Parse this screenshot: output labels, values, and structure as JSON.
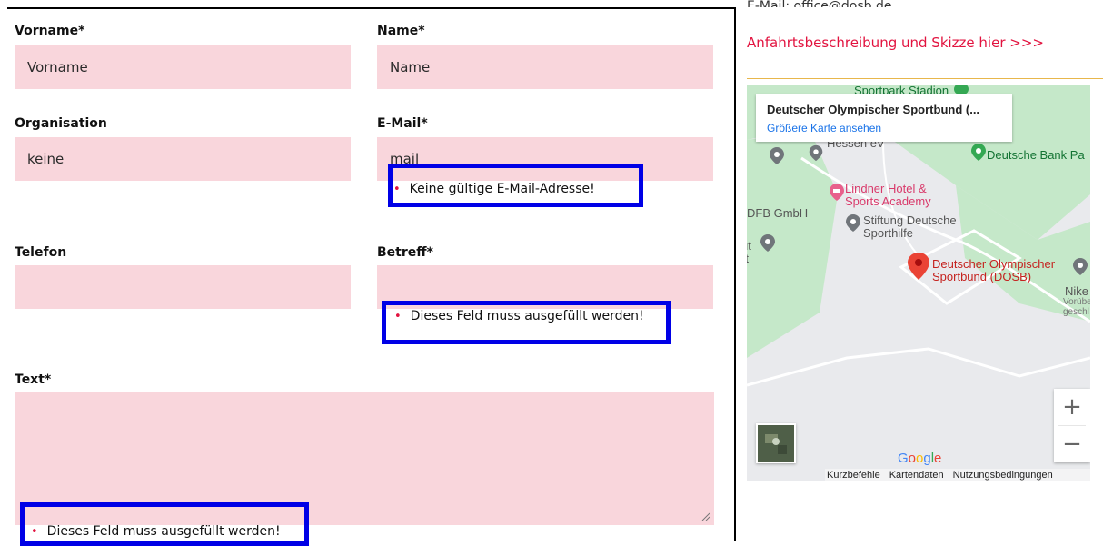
{
  "form": {
    "vorname": {
      "label": "Vorname",
      "required_mark": "*",
      "value": "Vorname"
    },
    "name": {
      "label": "Name",
      "required_mark": "*",
      "value": "Name"
    },
    "organisation": {
      "label": "Organisation",
      "value": "keine"
    },
    "email": {
      "label": "E-Mail",
      "required_mark": "*",
      "value": "mail",
      "error": "Keine gültige E-Mail-Adresse!"
    },
    "telefon": {
      "label": "Telefon",
      "value": ""
    },
    "betreff": {
      "label": "Betreff",
      "required_mark": "*",
      "value": "",
      "error": "Dieses Feld muss ausgefüllt werden!"
    },
    "text": {
      "label": "Text",
      "required_mark": "*",
      "value": "",
      "error": "Dieses Feld muss ausgefüllt werden!"
    },
    "error_bullet": "•"
  },
  "sidebar": {
    "email_text": "E-Mail: office@dosb.de",
    "directions_link": "Anfahrtsbeschreibung und Skizze hier >>>"
  },
  "map": {
    "place_title": "Deutscher Olympischer Sportbund (...",
    "larger_map_link": "Größere Karte ansehen",
    "labels": {
      "sportpark": "Sportpark Stadion",
      "landessportbund": "Landessportbund Hessen eV",
      "deutsche_bank": "Deutsche Bank Pa",
      "lindner": "Lindner Hotel & Sports Academy",
      "dfb": "DFB GmbH",
      "sporthilfe": "Stiftung Deutsche Sporthilfe",
      "dosb": "Deutscher Olympischer Sportbund (DOSB)",
      "nike": "Nike",
      "nike_sub": "Vorübe geschl",
      "left_cut1": "tj",
      "left_cut2": "ut rt"
    },
    "zoom_in": "+",
    "zoom_out": "−",
    "google": "Google",
    "footer": {
      "shortcuts": "Kurzbefehle",
      "map_data": "Kartendaten",
      "terms": "Nutzungsbedingungen"
    }
  },
  "colors": {
    "field_bg": "#f9d6dc",
    "accent_red": "#e2133f",
    "highlight": "#0000e6"
  }
}
